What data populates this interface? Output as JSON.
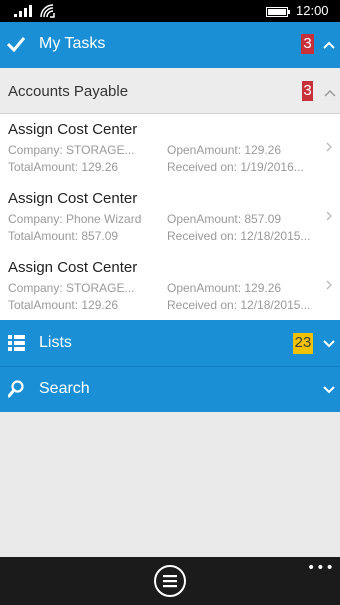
{
  "status": {
    "time": "12:00"
  },
  "header": {
    "title": "My Tasks",
    "badge": "3"
  },
  "group": {
    "title": "Accounts Payable",
    "badge": "3"
  },
  "tasks": [
    {
      "title": "Assign Cost Center",
      "company": "Company: STORAGE...",
      "open_amount": "OpenAmount: 129.26",
      "total_amount": "TotalAmount: 129.26",
      "received": "Received on: 1/19/2016..."
    },
    {
      "title": "Assign Cost Center",
      "company": "Company: Phone Wizard",
      "open_amount": "OpenAmount: 857.09",
      "total_amount": "TotalAmount: 857.09",
      "received": "Received on: 12/18/2015..."
    },
    {
      "title": "Assign Cost Center",
      "company": "Company: STORAGE...",
      "open_amount": "OpenAmount: 129.26",
      "total_amount": "TotalAmount: 129.26",
      "received": "Received on: 12/18/2015..."
    }
  ],
  "lists": {
    "title": "Lists",
    "badge": "23"
  },
  "search": {
    "title": "Search"
  },
  "icons": {
    "status": [
      "signal-icon",
      "wifi-icon",
      "battery-icon"
    ],
    "header": "checkmark-icon",
    "lists": "list-icon",
    "search": "search-icon",
    "chevron": "chevron-icon",
    "row": "chevron-right-icon",
    "app_bar": [
      "menu-icon",
      "more-icon"
    ]
  },
  "colors": {
    "accent": "#1a8fd5",
    "badge_red": "#c8303a",
    "badge_yellow": "#f2c200",
    "app_bar": "#1b1b1b"
  }
}
